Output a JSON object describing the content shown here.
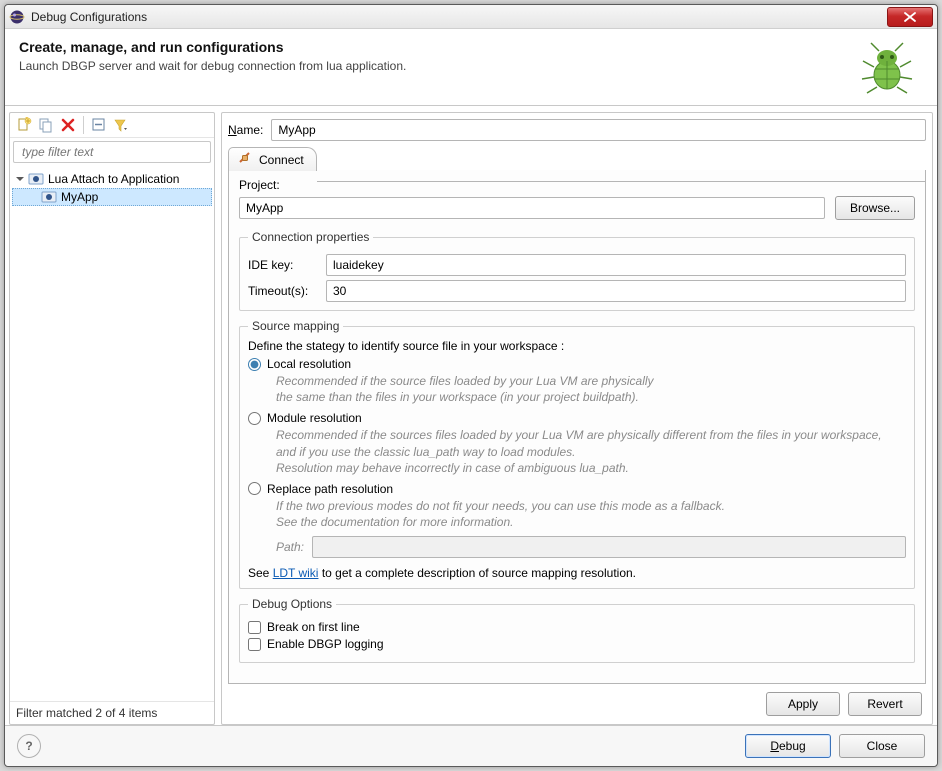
{
  "window": {
    "title": "Debug Configurations"
  },
  "header": {
    "title": "Create, manage, and run configurations",
    "subtitle": "Launch DBGP server and wait for debug connection from lua application."
  },
  "filter": {
    "placeholder": "type filter text",
    "status": "Filter matched 2 of 4 items"
  },
  "tree": {
    "parentLabel": "Lua Attach to Application",
    "childLabel": "MyApp"
  },
  "form": {
    "nameLabel": "Name:",
    "nameLabelChar": "N",
    "nameValue": "MyApp",
    "tabLabel": "Connect",
    "projectLabel": "Project:",
    "projectValue": "MyApp",
    "browse": "Browse...",
    "connGroup": "Connection properties",
    "ideKeyLabel": "IDE key:",
    "ideKeyValue": "luaidekey",
    "timeoutLabel": "Timeout(s):",
    "timeoutValue": "30",
    "srcGroup": "Source mapping",
    "srcDesc": "Define the stategy to identify source file in your workspace :",
    "radio1": "Local resolution",
    "radio1desc1": "Recommended if the source files loaded by your Lua VM are physically",
    "radio1desc2": "the same than the files in your workspace  (in your project buildpath).",
    "radio2": "Module resolution",
    "radio2desc1": "Recommended if the sources files loaded by your Lua VM are physically different from the files in your workspace,",
    "radio2desc2": "and if you use the classic lua_path way to load modules.",
    "radio2desc3": "Resolution may behave incorrectly in case of ambiguous lua_path.",
    "radio3": "Replace path resolution",
    "radio3desc1": "If the two previous modes do not fit your needs, you can use this mode as a fallback.",
    "radio3desc2": "See the documentation for more information.",
    "pathLabel": "Path:",
    "seeBefore": "See ",
    "ldtLink": "LDT wiki",
    "seeAfter": " to get a complete description of source mapping resolution.",
    "debugGroup": "Debug Options",
    "break1": "Break on first line",
    "break2": "Enable DBGP logging",
    "apply": "Apply",
    "revert": "Revert"
  },
  "buttons": {
    "debugChar": "D",
    "debugRest": "ebug",
    "close": "Close"
  }
}
